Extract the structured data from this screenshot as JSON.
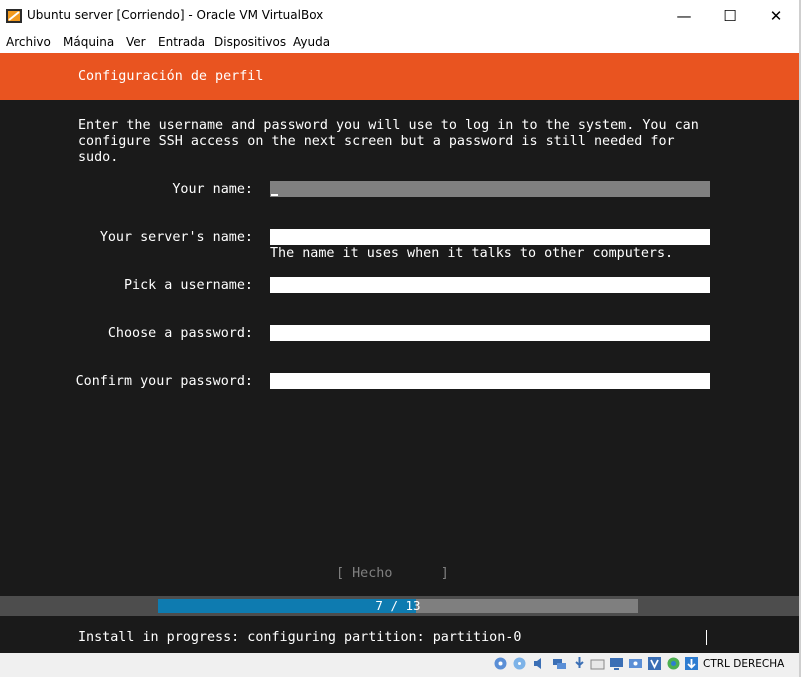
{
  "window": {
    "title": "Ubuntu server [Corriendo] - Oracle VM VirtualBox",
    "minimize_glyph": "—",
    "maximize_glyph": "☐",
    "close_glyph": "✕"
  },
  "menu": {
    "items": [
      "Archivo",
      "Máquina",
      "Ver",
      "Entrada",
      "Dispositivos",
      "Ayuda"
    ]
  },
  "installer": {
    "header_title": "Configuración de perfil",
    "intro": "Enter the username and password you will use to log in to the system. You can\nconfigure SSH access on the next screen but a password is still needed for\nsudo.",
    "fields": [
      {
        "label": "Your name:",
        "value": ""
      },
      {
        "label": "Your server's name:",
        "value": "",
        "hint": "The name it uses when it talks to other computers."
      },
      {
        "label": "Pick a username:",
        "value": ""
      },
      {
        "label": "Choose a password:",
        "value": ""
      },
      {
        "label": "Confirm your password:",
        "value": ""
      }
    ],
    "done_button": "[ Hecho      ]",
    "progress": {
      "text": "7 / 13",
      "current": 7,
      "total": 13
    },
    "status": "Install in progress: configuring partition: partition-0"
  },
  "statusbar": {
    "icons": [
      "hard-disk-icon",
      "optical-drive-icon",
      "audio-icon",
      "network-icon",
      "usb-icon",
      "shared-folders-icon",
      "display-icon",
      "recording-icon",
      "virtualization-icon",
      "mouse-integration-icon",
      "keyboard-capture-icon"
    ],
    "host_key": "CTRL DERECHA"
  },
  "colors": {
    "accent": "#e95420",
    "background": "#1a1a1a",
    "progress_fill": "#0e7bb0",
    "progress_track": "#7f7f7f"
  }
}
